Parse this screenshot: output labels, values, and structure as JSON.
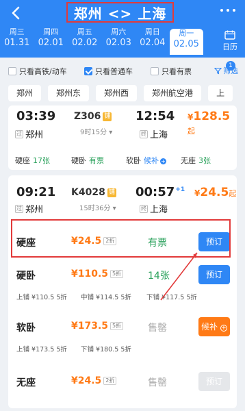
{
  "header": {
    "title": "郑州 <> 上海",
    "dates": [
      {
        "week": "周三",
        "date": "01.31"
      },
      {
        "week": "周四",
        "date": "02.01"
      },
      {
        "week": "周五",
        "date": "02.02"
      },
      {
        "week": "周六",
        "date": "02.03"
      },
      {
        "week": "周日",
        "date": "02.04"
      },
      {
        "week": "周一",
        "date": "02.05",
        "active": true
      }
    ],
    "calendar_label": "日历"
  },
  "filters": {
    "gaotie": "只看高铁/动车",
    "putong": "只看普通车",
    "youpiao": "只看有票",
    "filter_label": "筛选",
    "badge": "1"
  },
  "stations": [
    "郑州",
    "郑州东",
    "郑州西",
    "郑州航空港",
    "上"
  ],
  "trains": [
    {
      "depart": "03:39",
      "arrive": "12:54",
      "train_no": "Z306",
      "pu": "铺",
      "duration": "9时15分",
      "from_tag": "过",
      "from": "郑州",
      "to_tag": "终",
      "to": "上海",
      "yen": "¥",
      "price": "128.5",
      "qi": "起",
      "seats": [
        {
          "name": "硬座",
          "count": "17张"
        },
        {
          "name": "硬卧",
          "count": "有票"
        },
        {
          "name": "软卧",
          "count": "候补",
          "plus": "+"
        },
        {
          "name": "无座",
          "count": "3张"
        }
      ]
    },
    {
      "depart": "09:21",
      "arrive": "00:57",
      "arrive_plus": "+1",
      "train_no": "K4028",
      "pu": "铺",
      "duration": "15时36分",
      "from_tag": "过",
      "from": "郑州",
      "to_tag": "终",
      "to": "上海",
      "yen": "¥",
      "price": "24.5",
      "qi": "起"
    }
  ],
  "seat_details": [
    {
      "name": "硬座",
      "price": "¥24.5",
      "discount": "2折",
      "status": "有票",
      "button": "预订"
    },
    {
      "name": "硬卧",
      "price": "¥110.5",
      "discount": "5折",
      "status": "14张",
      "button": "预订",
      "sub": [
        {
          "label": "上铺",
          "price": "¥110.5",
          "discount": "5折"
        },
        {
          "label": "中铺",
          "price": "¥114.5",
          "discount": "5折"
        },
        {
          "label": "下铺",
          "price": "¥117.5",
          "discount": "5折"
        }
      ]
    },
    {
      "name": "软卧",
      "price": "¥173.5",
      "discount": "5折",
      "status": "售罄",
      "button": "候补",
      "sub": [
        {
          "label": "上铺",
          "price": "¥173.5",
          "discount": "5折"
        },
        {
          "label": "下铺",
          "price": "¥180.5",
          "discount": "5折"
        }
      ]
    },
    {
      "name": "无座",
      "price": "¥24.5",
      "discount": "2折",
      "status": "售罄",
      "button": "预订"
    }
  ],
  "colors": {
    "brand": "#2f87f5",
    "price": "#ff7a16",
    "available": "#2aa15b",
    "annotation": "#e23a3a"
  }
}
